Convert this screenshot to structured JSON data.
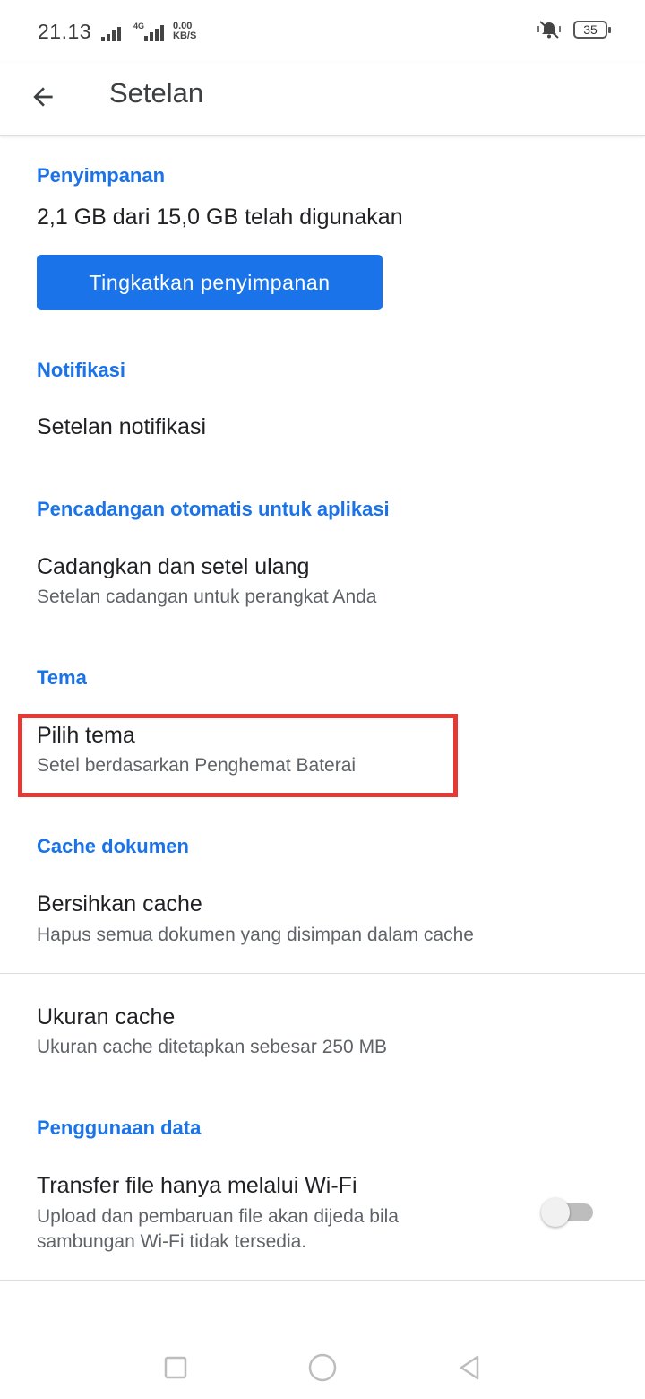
{
  "status_bar": {
    "time": "21.13",
    "network_type": "4G",
    "net_speed_value": "0.00",
    "net_speed_unit": "KB/S",
    "battery_level": "35",
    "icons": [
      "signal-icon",
      "signal-4g-icon",
      "vibrate-icon",
      "battery-icon"
    ]
  },
  "app_bar": {
    "title": "Setelan",
    "back_icon": "arrow-back-icon"
  },
  "storage": {
    "header": "Penyimpanan",
    "usage_text": "2,1 GB dari 15,0 GB telah digunakan",
    "upgrade_button": "Tingkatkan penyimpanan"
  },
  "notifications": {
    "header": "Notifikasi",
    "item_title": "Setelan notifikasi"
  },
  "backup": {
    "header": "Pencadangan otomatis untuk aplikasi",
    "item_title": "Cadangkan dan setel ulang",
    "item_sub": "Setelan cadangan untuk perangkat Anda"
  },
  "theme": {
    "header": "Tema",
    "item_title": "Pilih tema",
    "item_sub": "Setel berdasarkan Penghemat Baterai"
  },
  "cache": {
    "header": "Cache dokumen",
    "clear_title": "Bersihkan cache",
    "clear_sub": "Hapus semua dokumen yang disimpan dalam cache",
    "size_title": "Ukuran cache",
    "size_sub": "Ukuran cache ditetapkan sebesar 250 MB"
  },
  "data_usage": {
    "header": "Penggunaan data",
    "wifi_title": "Transfer file hanya melalui Wi-Fi",
    "wifi_sub_line1": "Upload dan pembaruan file akan dijeda bila",
    "wifi_sub_line2": "sambungan Wi-Fi tidak tersedia.",
    "wifi_toggle_on": false
  },
  "nav_bar": {
    "icons": [
      "recents-square-icon",
      "home-circle-icon",
      "back-triangle-icon"
    ]
  },
  "colors": {
    "accent": "#1a73e8",
    "highlight": "#e53935",
    "text_primary": "#202124",
    "text_secondary": "#5f6368"
  }
}
